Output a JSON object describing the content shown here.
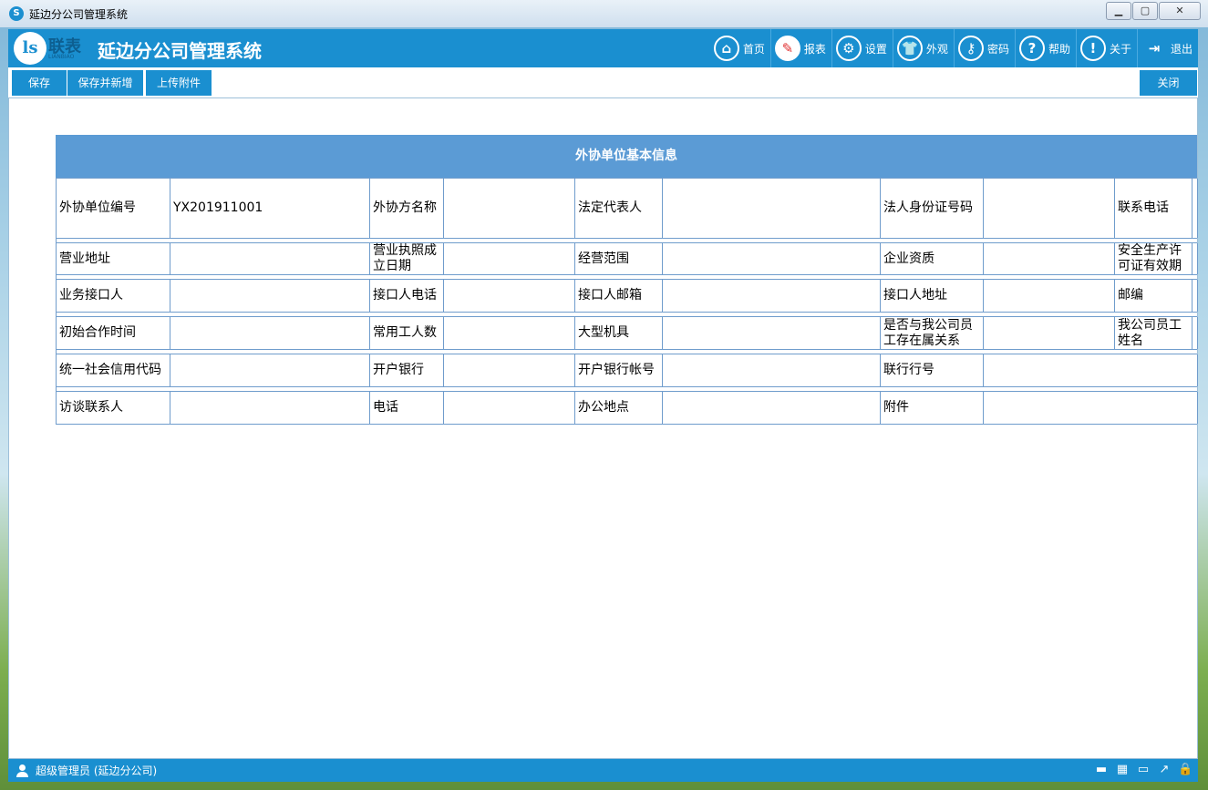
{
  "window": {
    "title": "延边分公司管理系统",
    "icon_text": "S"
  },
  "header": {
    "logo_text": "联表",
    "logo_sub": "LIANBIAO",
    "system_title": "延边分公司管理系统",
    "nav": [
      {
        "label": "首页",
        "icon": "home-icon",
        "glyph": "⌂"
      },
      {
        "label": "报表",
        "icon": "report-icon",
        "glyph": "✎"
      },
      {
        "label": "设置",
        "icon": "gear-icon",
        "glyph": "⚙"
      },
      {
        "label": "外观",
        "icon": "shirt-icon",
        "glyph": "👕"
      },
      {
        "label": "密码",
        "icon": "key-icon",
        "glyph": "⚷"
      },
      {
        "label": "帮助",
        "icon": "help-icon",
        "glyph": "?"
      },
      {
        "label": "关于",
        "icon": "about-icon",
        "glyph": "!"
      },
      {
        "label": "退出",
        "icon": "exit-icon",
        "glyph": "⇥"
      }
    ]
  },
  "toolbar": {
    "save": "保存",
    "save_new": "保存并新增",
    "upload": "上传附件",
    "close": "关闭"
  },
  "form": {
    "title": "外协单位基本信息",
    "rows": [
      [
        "外协单位编号",
        "YX201911001",
        "外协方名称",
        "",
        "法定代表人",
        "",
        "法人身份证号码",
        "",
        "联系电话",
        ""
      ],
      [
        "营业地址",
        "",
        "营业执照成立日期",
        "",
        "经营范围",
        "",
        "企业资质",
        "",
        "安全生产许可证有效期",
        ""
      ],
      [
        "业务接口人",
        "",
        "接口人电话",
        "",
        "接口人邮箱",
        "",
        "接口人地址",
        "",
        "邮编",
        ""
      ],
      [
        "初始合作时间",
        "",
        "常用工人数",
        "",
        "大型机具",
        "",
        "是否与我公司员工存在属关系",
        "",
        "我公司员工姓名",
        ""
      ],
      [
        "统一社会信用代码",
        "",
        "开户银行",
        "",
        "开户银行帐号",
        "",
        "联行行号",
        ""
      ],
      [
        "访谈联系人",
        "",
        "电话",
        "",
        "办公地点",
        "",
        "附件",
        ""
      ]
    ]
  },
  "status": {
    "user": "超级管理员 (延边分公司)"
  }
}
